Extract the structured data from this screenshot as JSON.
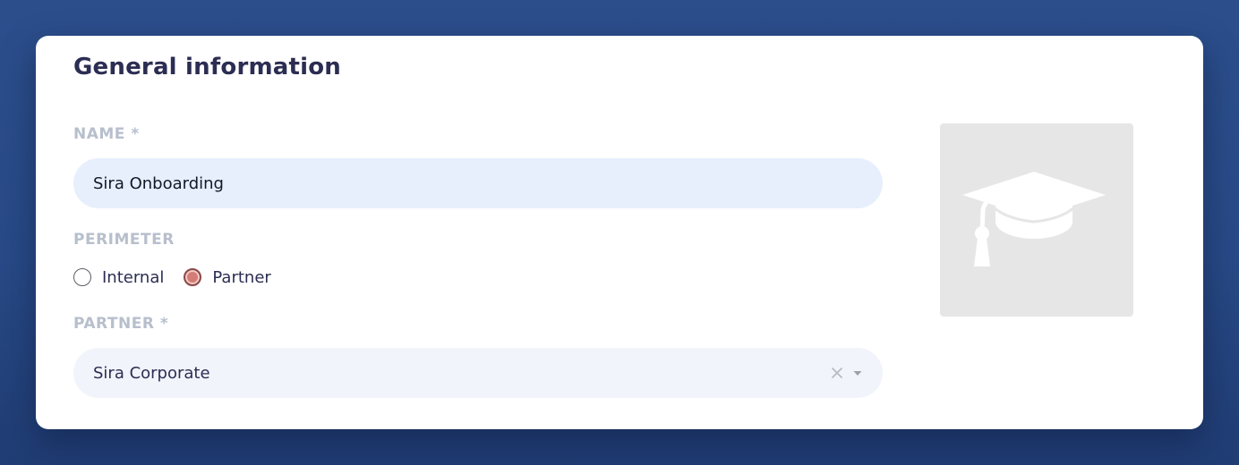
{
  "section": {
    "title": "General information"
  },
  "form": {
    "name": {
      "label": "NAME *",
      "value": "Sira Onboarding"
    },
    "perimeter": {
      "label": "PERIMETER",
      "options": [
        {
          "label": "Internal",
          "selected": false
        },
        {
          "label": "Partner",
          "selected": true
        }
      ]
    },
    "partner": {
      "label": "PARTNER *",
      "selected_value": "Sira Corporate",
      "clear_icon": "close-icon",
      "caret_icon": "caret-down-icon"
    }
  },
  "image": {
    "icon": "graduation-cap-icon"
  },
  "colors": {
    "background": "#2a4c89",
    "card": "#ffffff",
    "title": "#2b2d52",
    "label": "#b7bfcd",
    "name_input_bg": "#e7effc",
    "select_bg": "#f1f4fa",
    "radio_checked": "#d47c77",
    "placeholder_bg": "#e6e6e6"
  }
}
